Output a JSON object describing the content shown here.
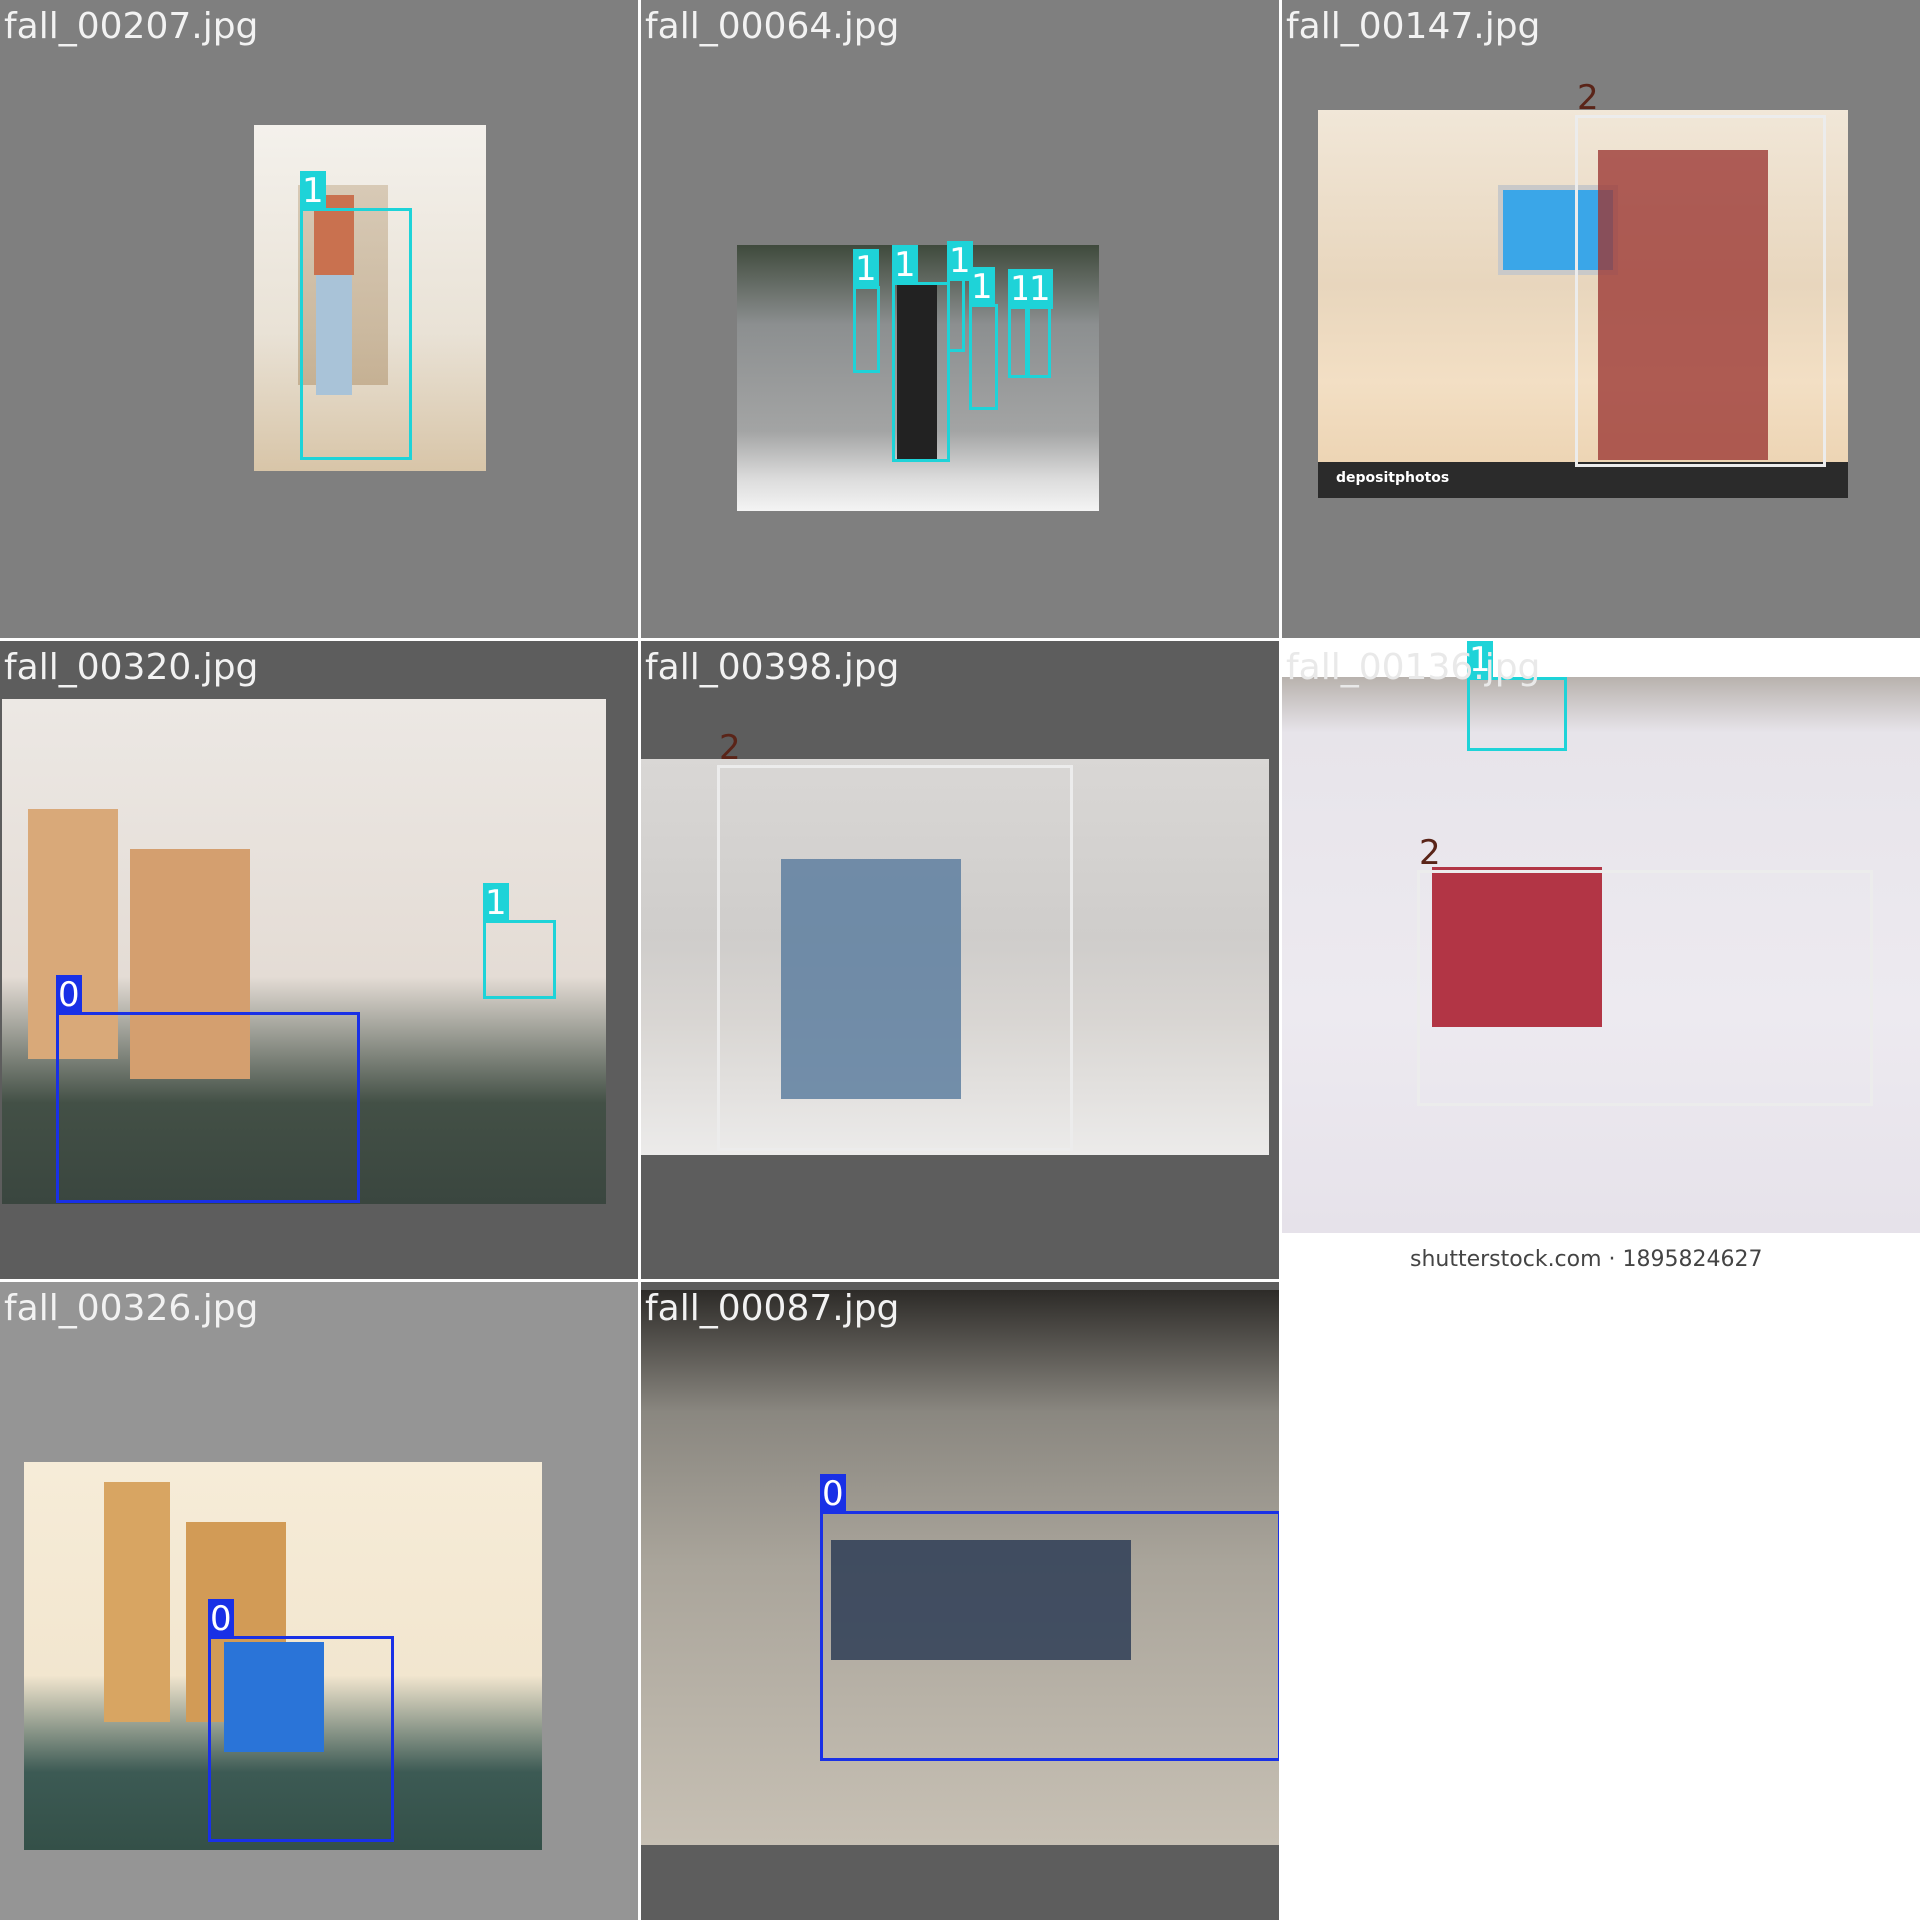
{
  "colors": {
    "class_0": "#1930e6",
    "class_1": "#1ed3d8",
    "class_2": "#ececec",
    "tile_gray": "#7f7f7f",
    "tile_darkgray": "#5d5d5d",
    "tile_lightgray": "#959595"
  },
  "tiles": [
    {
      "filename": "fall_00207.jpg",
      "labels": [
        "1"
      ]
    },
    {
      "filename": "fall_00064.jpg",
      "labels": [
        "1",
        "1",
        "1",
        "1",
        "1",
        "1"
      ]
    },
    {
      "filename": "fall_00147.jpg",
      "labels": [
        "2"
      ],
      "watermark_brand": "depositphotos"
    },
    {
      "filename": "fall_00320.jpg",
      "labels": [
        "0",
        "1"
      ]
    },
    {
      "filename": "fall_00398.jpg",
      "labels": [
        "2"
      ]
    },
    {
      "filename": "fall_00136.jpg",
      "labels": [
        "1",
        "2"
      ],
      "watermark": "shutterstock.com · 1895824627"
    },
    {
      "filename": "fall_00326.jpg",
      "labels": [
        "0"
      ]
    },
    {
      "filename": "fall_00087.jpg",
      "labels": [
        "0"
      ]
    }
  ]
}
